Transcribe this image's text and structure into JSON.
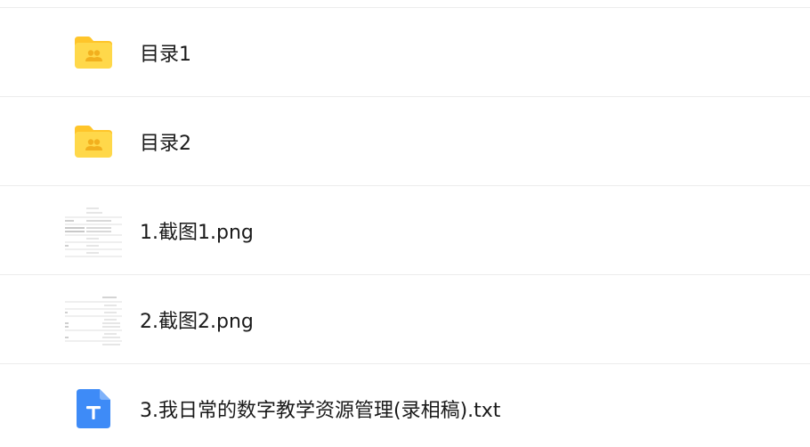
{
  "items": [
    {
      "name": "目录1",
      "type": "folder",
      "icon": "shared-folder-icon"
    },
    {
      "name": "目录2",
      "type": "folder",
      "icon": "shared-folder-icon"
    },
    {
      "name": "1.截图1.png",
      "type": "image",
      "icon": "image-thumbnail"
    },
    {
      "name": "2.截图2.png",
      "type": "image",
      "icon": "image-thumbnail"
    },
    {
      "name": "3.我日常的数字教学资源管理(录相稿).txt",
      "type": "text",
      "icon": "txt-file-icon"
    }
  ],
  "colors": {
    "folder": "#FFD13D",
    "folder_tab": "#FFC52A",
    "folder_glyph": "#F5B522",
    "txt_icon": "#3E8BF7",
    "divider": "#ECECEC",
    "text": "#1A1A1A"
  }
}
